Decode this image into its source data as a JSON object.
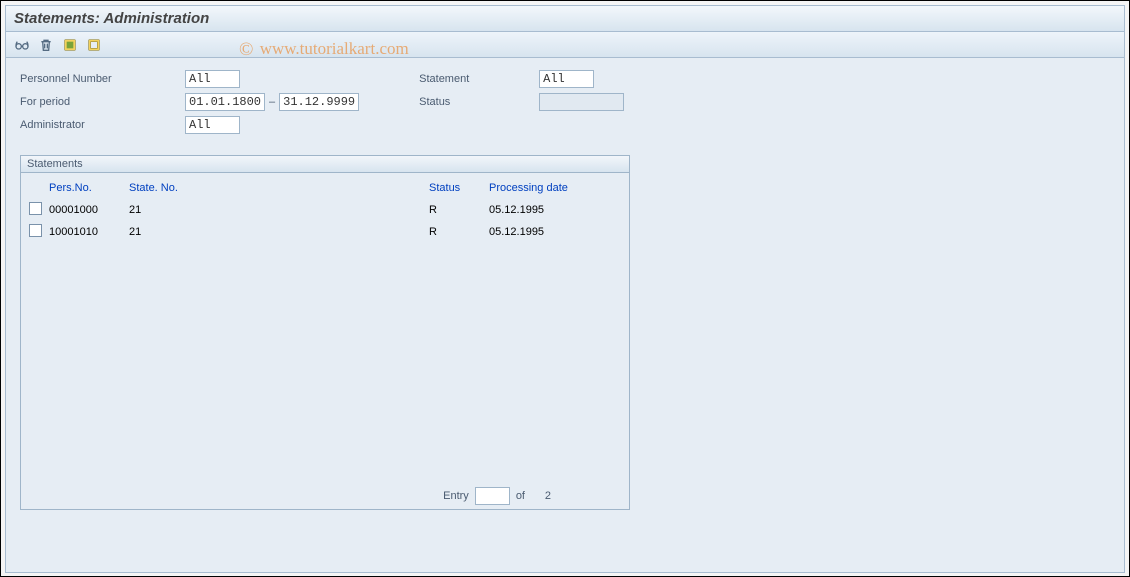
{
  "window": {
    "title": "Statements: Administration"
  },
  "filters": {
    "personnel_number_label": "Personnel Number",
    "personnel_number_value": "All",
    "for_period_label": "For period",
    "for_period_from": "01.01.1800",
    "for_period_to": "31.12.9999",
    "administrator_label": "Administrator",
    "administrator_value": "All",
    "statement_label": "Statement",
    "statement_value": "All",
    "status_label": "Status",
    "status_value": ""
  },
  "panel": {
    "title": "Statements",
    "columns": {
      "persno": "Pers.No.",
      "stateno": "State. No.",
      "status": "Status",
      "procdate": "Processing date"
    },
    "rows": [
      {
        "persno": "00001000",
        "stateno": "21",
        "status": "R",
        "procdate": "05.12.1995"
      },
      {
        "persno": "10001010",
        "stateno": "21",
        "status": "R",
        "procdate": "05.12.1995"
      }
    ],
    "footer": {
      "entry_label": "Entry",
      "entry_value": "",
      "of_label": "of",
      "total": "2"
    }
  },
  "watermark": "www.tutorialkart.com"
}
